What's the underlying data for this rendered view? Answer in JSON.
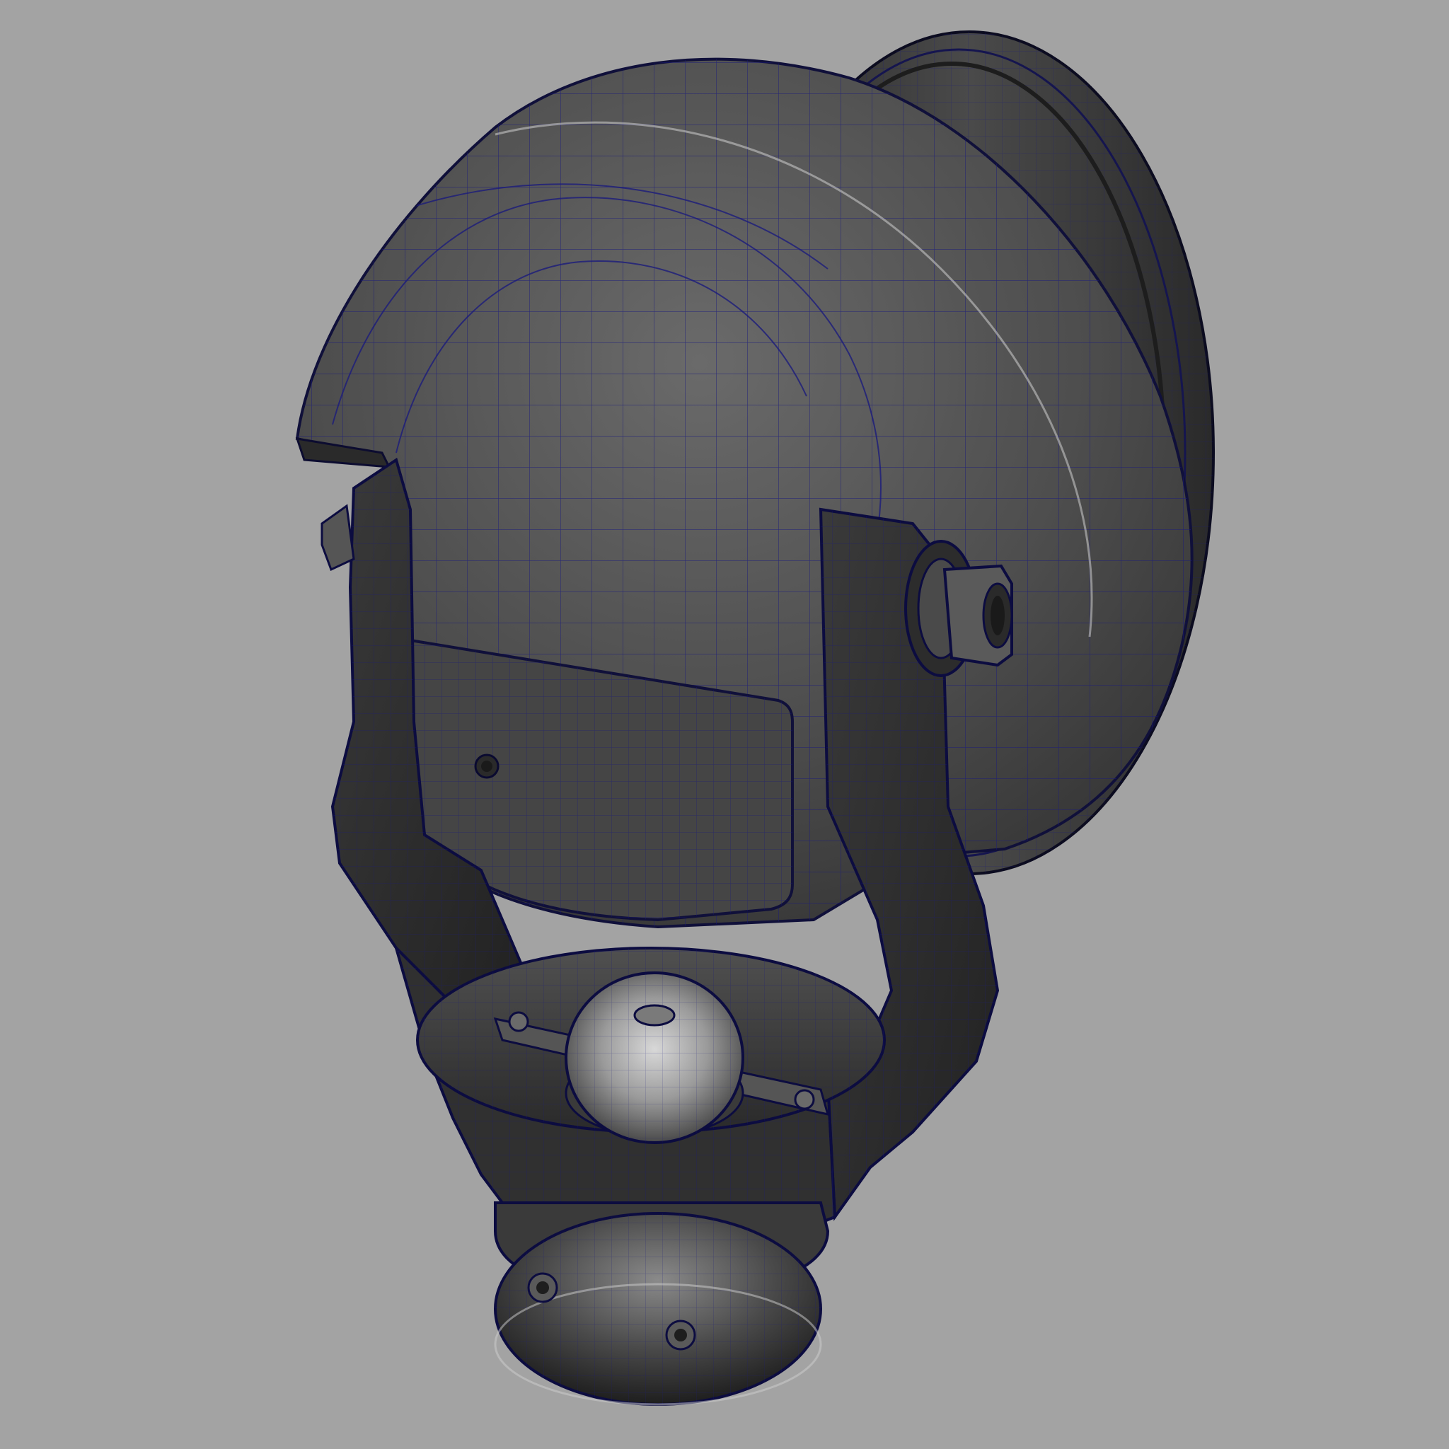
{
  "viewport": {
    "background_color": "#a3a3a3"
  },
  "model": {
    "subject": "searchlight-wireframe-render",
    "shading_colors": {
      "body_dark": "#2e2e2e",
      "body_mid": "#4f4f4f",
      "body_light": "#6e6e6e",
      "highlight": "#bdbdbd",
      "wireframe": "#1a1a7a"
    },
    "parts": [
      "rear-housing",
      "front-bezel-rim",
      "rear-access-panel",
      "yoke-bracket",
      "pivot-bolt-right",
      "pivot-bolt-left",
      "turret-plate",
      "center-cap-dome",
      "base-pedestal",
      "mounting-screws"
    ]
  }
}
